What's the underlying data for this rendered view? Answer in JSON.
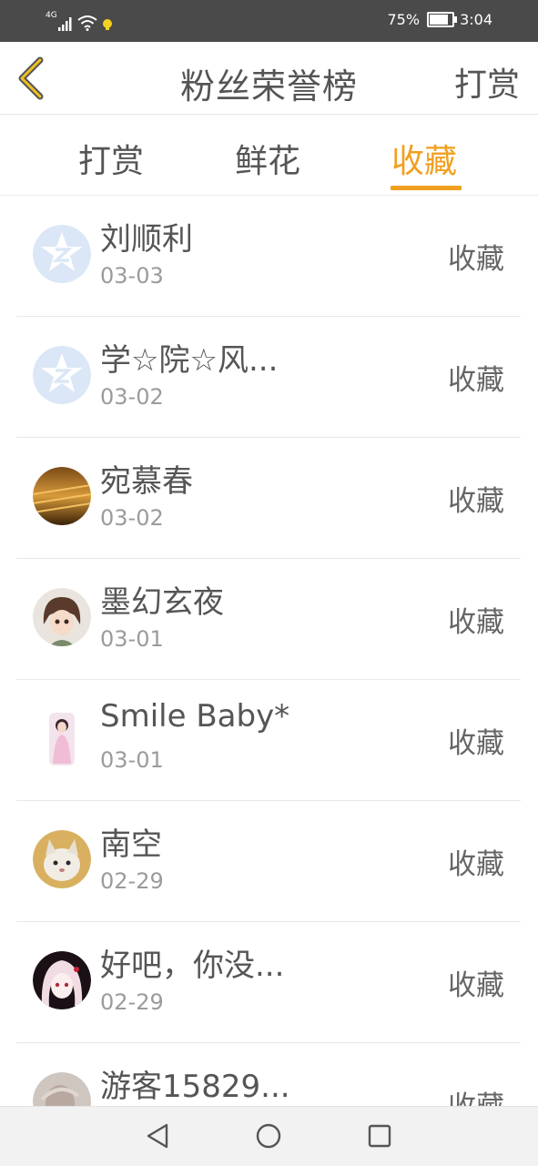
{
  "status_bar": {
    "network": "4G",
    "battery": "75%",
    "battery_level": 0.75,
    "time": "3:04"
  },
  "header": {
    "title": "粉丝荣誉榜",
    "right_action": "打赏"
  },
  "tabs": [
    {
      "label": "打赏",
      "active": false
    },
    {
      "label": "鲜花",
      "active": false
    },
    {
      "label": "收藏",
      "active": true
    }
  ],
  "colors": {
    "accent": "#f0a020",
    "status_bar": "#4a4a4a",
    "text": "#555555",
    "subtext": "#9b9b9b"
  },
  "fans": [
    {
      "name": "刘顺利",
      "date": "03-03",
      "action": "收藏",
      "avatar": "default-qq-icon"
    },
    {
      "name": "学☆院☆风...",
      "date": "03-02",
      "action": "收藏",
      "avatar": "default-qq-icon"
    },
    {
      "name": "宛慕春",
      "date": "03-02",
      "action": "收藏",
      "avatar": "photo-avatar"
    },
    {
      "name": "墨幻玄夜",
      "date": "03-01",
      "action": "收藏",
      "avatar": "anime-avatar"
    },
    {
      "name": "Smile Baby*",
      "date": "03-01",
      "action": "收藏",
      "avatar": "photo-avatar"
    },
    {
      "name": "南空",
      "date": "02-29",
      "action": "收藏",
      "avatar": "cat-avatar"
    },
    {
      "name": "好吧，你没...",
      "date": "02-29",
      "action": "收藏",
      "avatar": "anime-avatar"
    },
    {
      "name": "游客15829...",
      "date": "",
      "action": "收藏",
      "avatar": "photo-avatar"
    }
  ],
  "nav_bar": {
    "icons": [
      "back-triangle-icon",
      "home-circle-icon",
      "recents-square-icon"
    ]
  }
}
